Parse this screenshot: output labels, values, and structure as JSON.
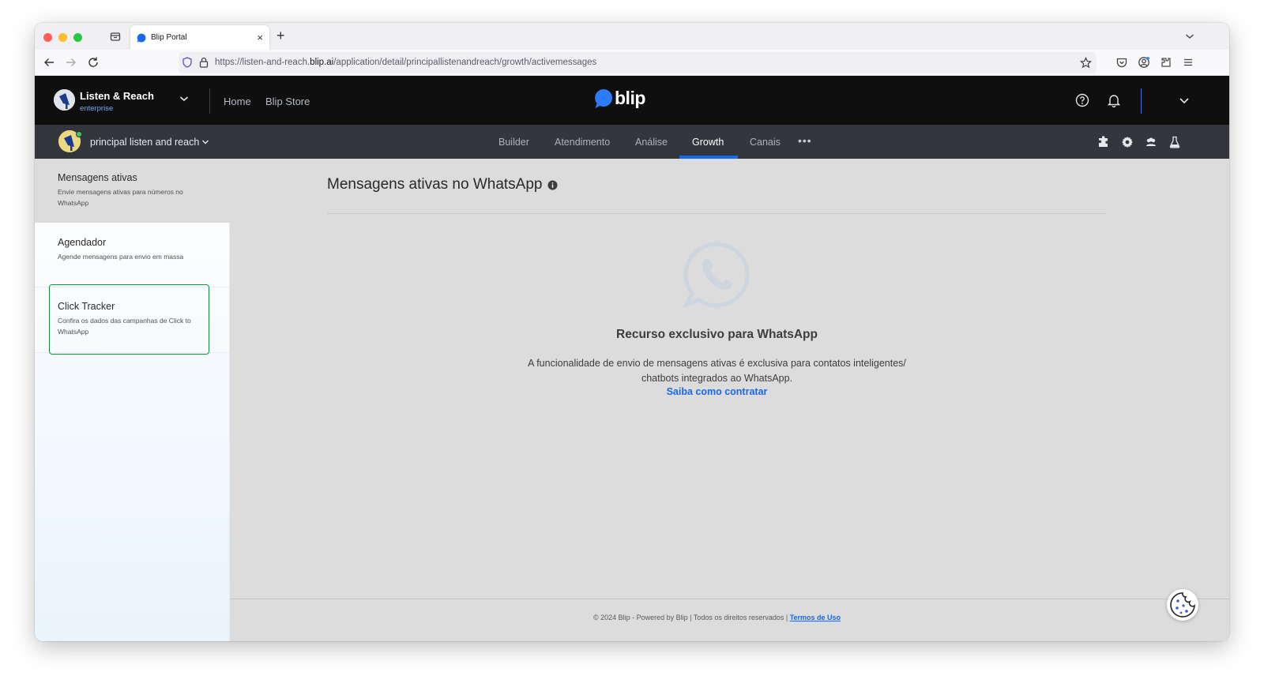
{
  "browser": {
    "tab_title": "Blip Portal",
    "url_prefix": "https://listen-and-reach.",
    "url_domain": "blip.ai",
    "url_path": "/application/detail/principallistenandreach/growth/activemessages"
  },
  "header": {
    "org_name": "Listen & Reach",
    "org_plan": "enterprise",
    "links": [
      "Home",
      "Blip Store"
    ],
    "logo_text": "blip"
  },
  "subnav": {
    "bot_name": "principal listen and reach",
    "tabs": [
      "Builder",
      "Atendimento",
      "Análise",
      "Growth",
      "Canais"
    ],
    "active_tab": "Growth",
    "more": "•••"
  },
  "sidebar": {
    "items": [
      {
        "title": "Mensagens ativas",
        "desc": "Envie mensagens ativas para números no WhatsApp"
      },
      {
        "title": "Agendador",
        "desc": "Agende mensagens para envio em massa"
      },
      {
        "title": "Click Tracker",
        "desc": "Confira os dados das campanhas de Click to WhatsApp"
      }
    ]
  },
  "main": {
    "title": "Mensagens ativas no WhatsApp",
    "empty_title": "Recurso exclusivo para WhatsApp",
    "empty_desc_line1": "A funcionalidade de envio de mensagens ativas é exclusiva para contatos inteligentes/",
    "empty_desc_line2": "chatbots integrados ao WhatsApp.",
    "empty_link": "Saiba como contratar"
  },
  "footer": {
    "text": "© 2024 Blip - Powered by Blip | Todos os direitos reservados | ",
    "link": "Termos de Uso"
  },
  "colors": {
    "accent": "#1968f0",
    "topbar": "#0f0f10",
    "subbar": "#33363b",
    "focus": "#12933a"
  }
}
